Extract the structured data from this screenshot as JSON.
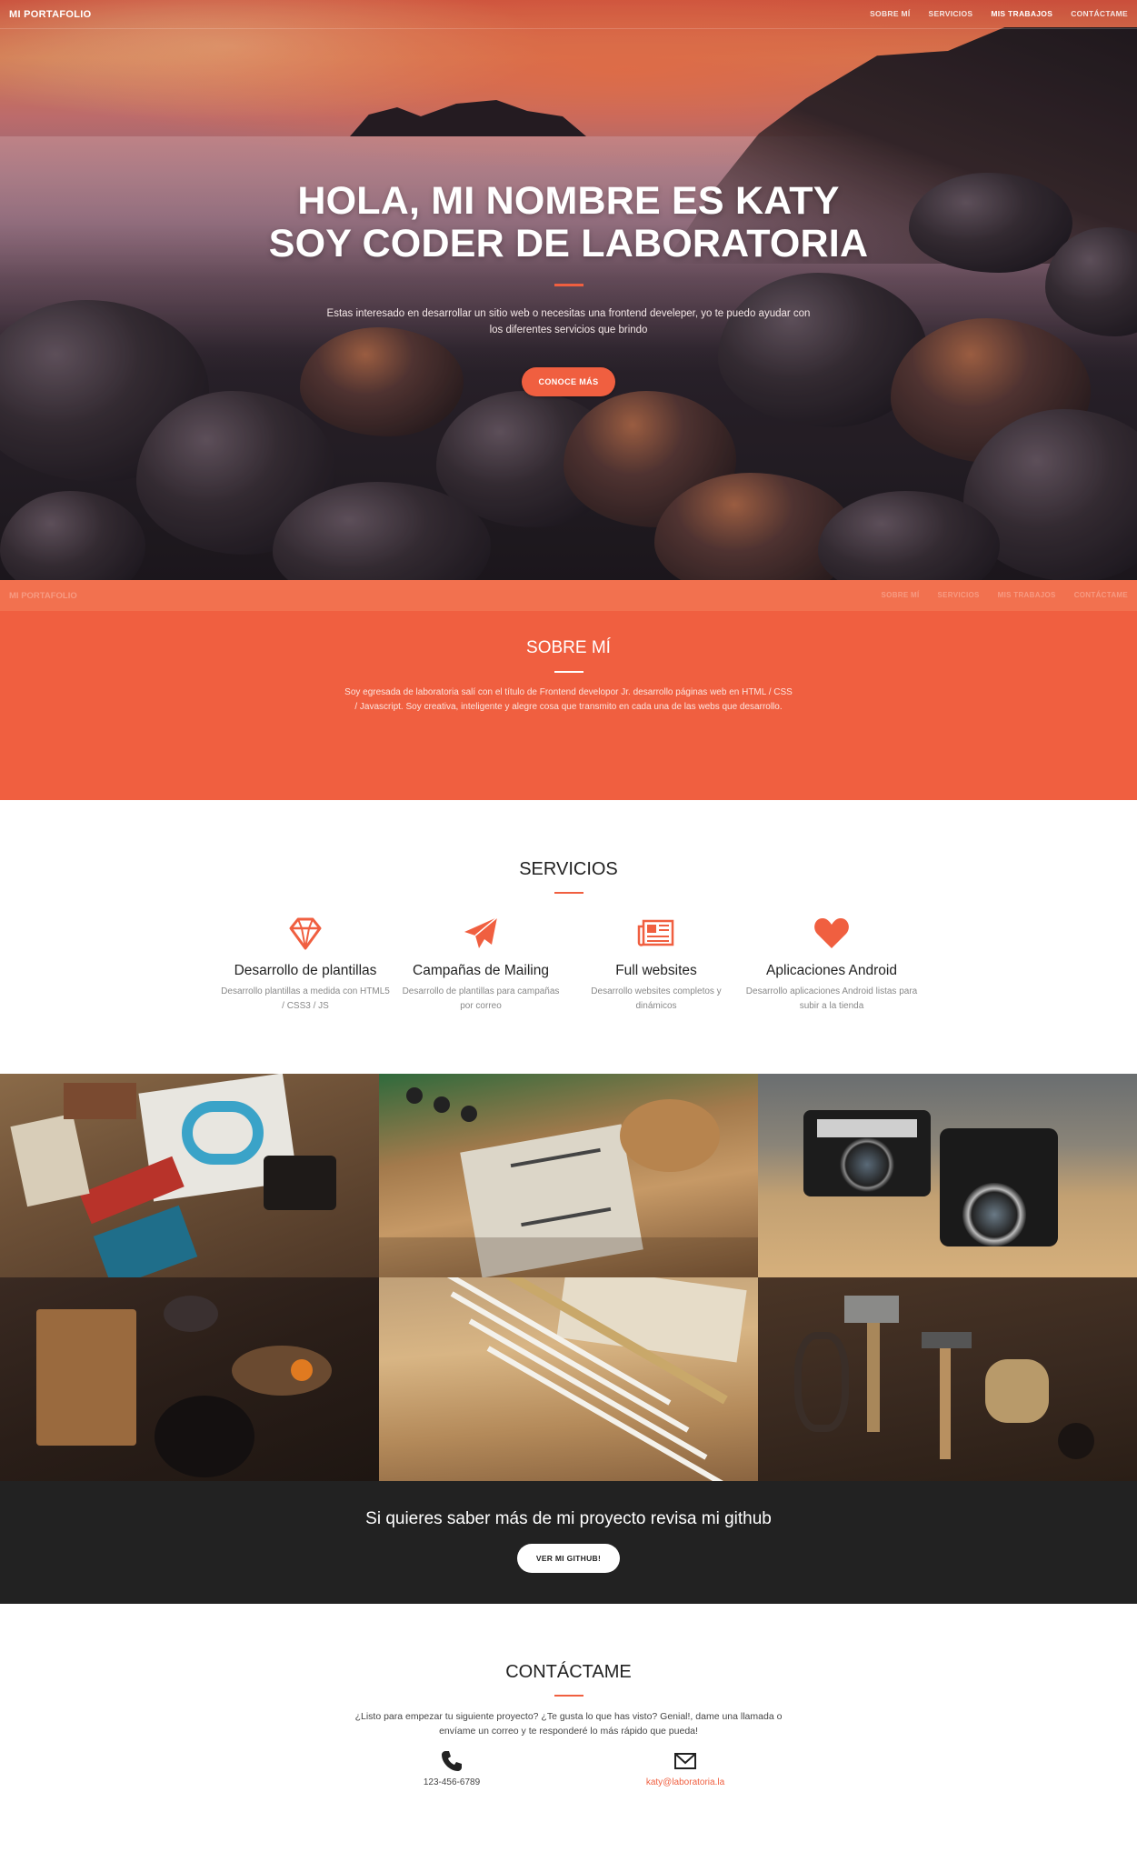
{
  "nav": {
    "brand": "MI PORTAFOLIO",
    "links": [
      "SOBRE MÍ",
      "SERVICIOS",
      "MIS TRABAJOS",
      "CONTÁCTAME"
    ],
    "active": "MIS TRABAJOS"
  },
  "hero": {
    "title_line1": "HOLA, MI NOMBRE ES KATY",
    "title_line2": "SOY CODER DE LABORATORIA",
    "text": "Estas interesado en desarrollar un sitio web o necesitas una frontend develeper, yo te puedo ayudar con los diferentes servicios que brindo",
    "button": "CONOCE MÁS"
  },
  "about": {
    "title": "SOBRE MÍ",
    "text": "Soy egresada de laboratoria salí con el título de Frontend developor Jr. desarrollo páginas web en HTML / CSS / Javascript. Soy creativa, inteligente y alegre cosa que transmito en cada una de las webs que desarrollo."
  },
  "services": {
    "title": "SERVICIOS",
    "items": [
      {
        "icon": "diamond-icon",
        "title": "Desarrollo de plantillas",
        "text": "Desarrollo plantillas a medida con HTML5 / CSS3 / JS"
      },
      {
        "icon": "paper-plane-icon",
        "title": "Campañas de Mailing",
        "text": "Desarrollo de plantillas para campañas por correo"
      },
      {
        "icon": "newspaper-icon",
        "title": "Full websites",
        "text": "Desarrollo websites completos y dinámicos"
      },
      {
        "icon": "heart-icon",
        "title": "Aplicaciones Android",
        "text": "Desarrollo aplicaciones Android listas para subir a la tienda"
      }
    ]
  },
  "gallery": {
    "items": [
      "workbench-flatlay-photo",
      "notebook-desk-photo",
      "vintage-cameras-photo",
      "kitchen-table-photo",
      "pencils-photo",
      "tools-photo"
    ]
  },
  "github": {
    "text": "Si quieres saber más de mi proyecto revisa mi github",
    "button": "VER MI GITHUB!"
  },
  "contact": {
    "title": "CONTÁCTAME",
    "text": "¿Listo para empezar tu siguiente proyecto? ¿Te gusta lo que has visto? Genial!, dame una llamada o envíame un correo y te responderé lo más rápido que pueda!",
    "phone": "123-456-6789",
    "email": "katy@laboratoria.la"
  },
  "colors": {
    "accent": "#f05f40",
    "dark": "#222222"
  }
}
